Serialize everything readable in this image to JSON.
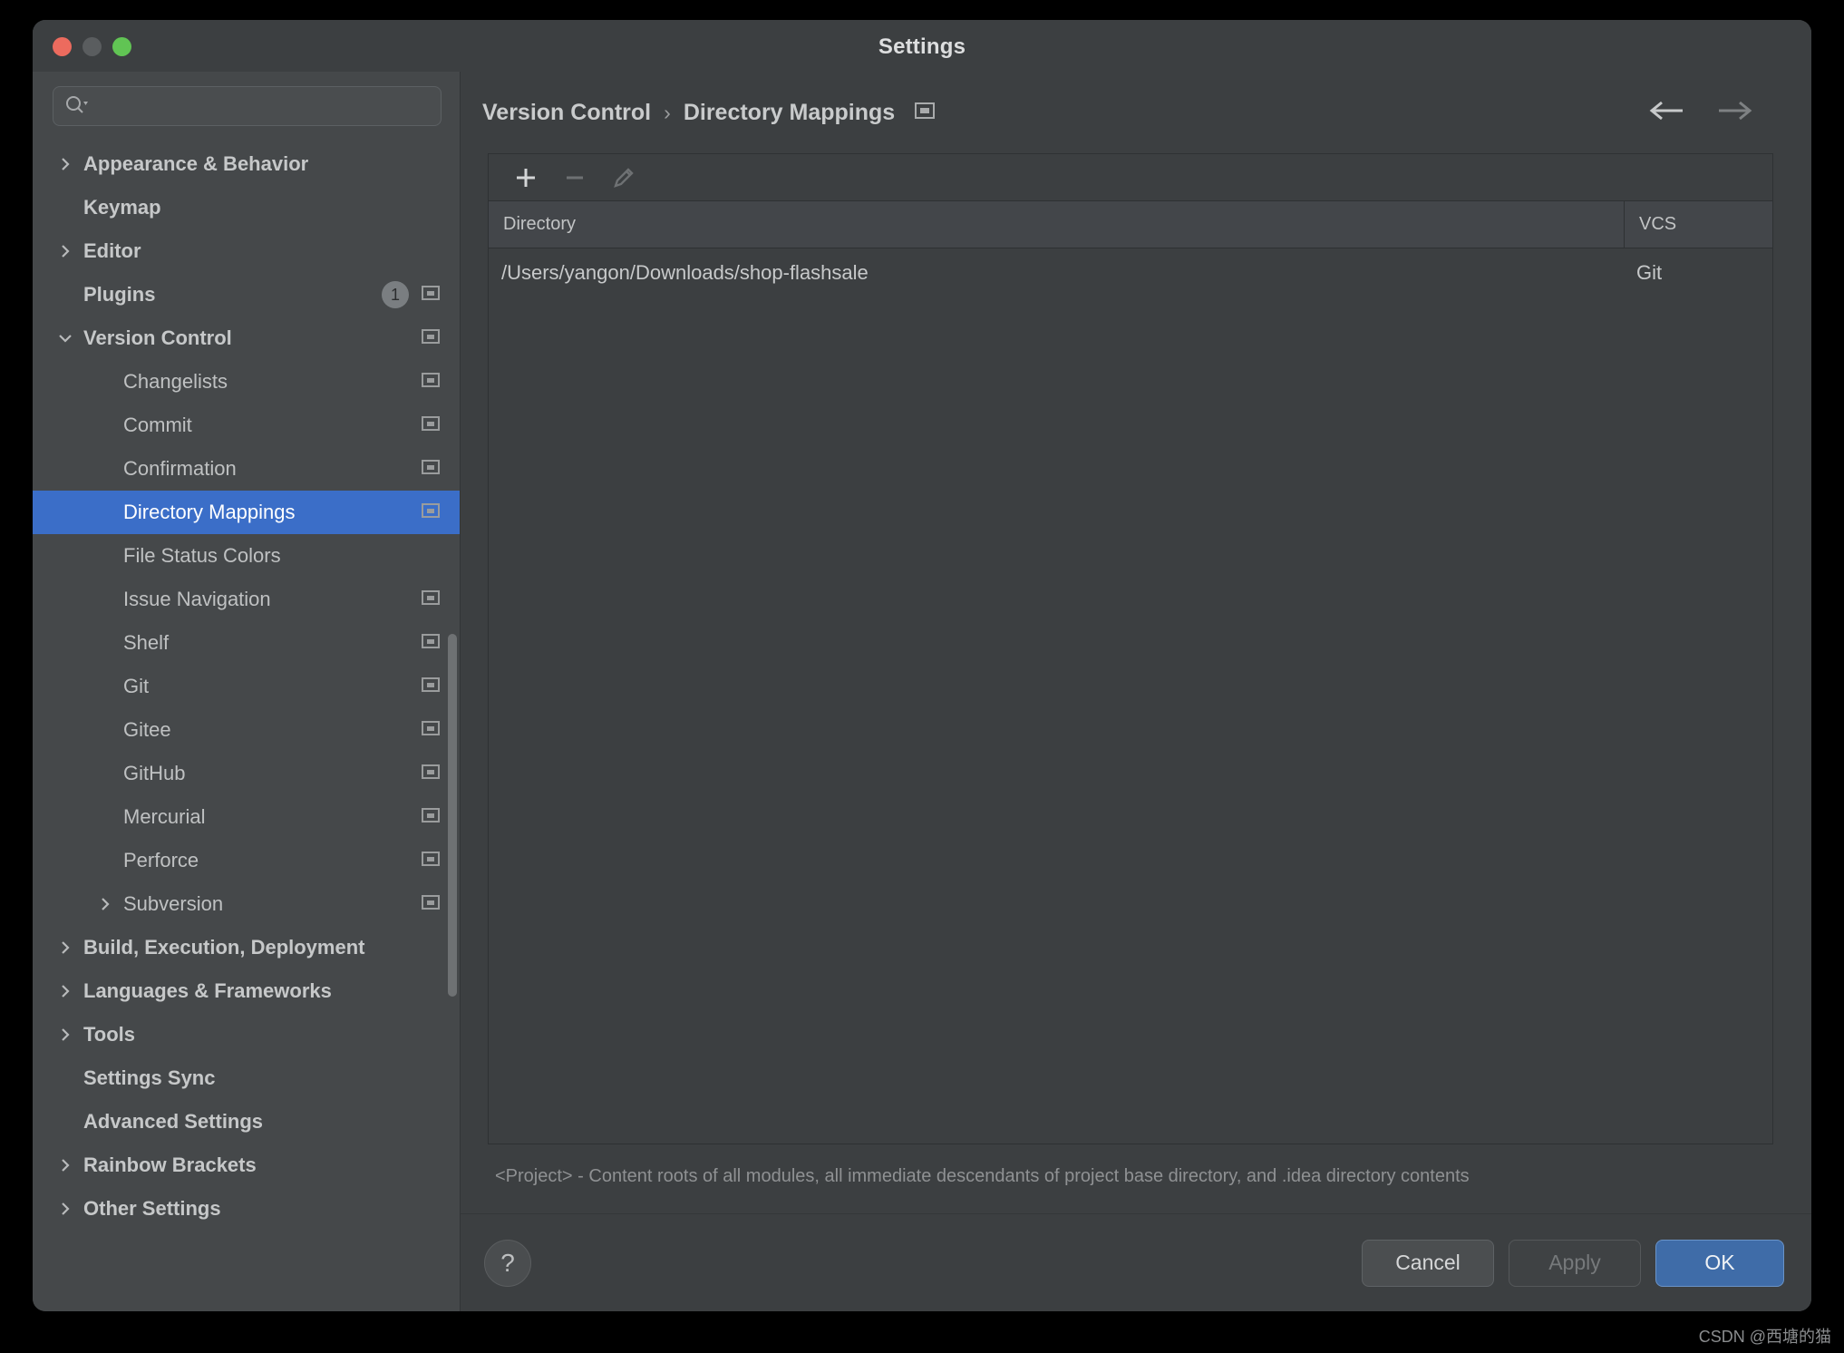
{
  "window": {
    "title": "Settings",
    "traffic_lights": [
      "close",
      "minimize",
      "zoom"
    ]
  },
  "search": {
    "value": "",
    "placeholder": ""
  },
  "sidebar": {
    "items": [
      {
        "label": "Appearance & Behavior",
        "depth": 0,
        "arrow": "right",
        "bold": true,
        "selected": false,
        "badge": null,
        "project_icon": false
      },
      {
        "label": "Keymap",
        "depth": 0,
        "arrow": "",
        "bold": true,
        "selected": false,
        "badge": null,
        "project_icon": false
      },
      {
        "label": "Editor",
        "depth": 0,
        "arrow": "right",
        "bold": true,
        "selected": false,
        "badge": null,
        "project_icon": false
      },
      {
        "label": "Plugins",
        "depth": 0,
        "arrow": "",
        "bold": true,
        "selected": false,
        "badge": "1",
        "project_icon": true
      },
      {
        "label": "Version Control",
        "depth": 0,
        "arrow": "down",
        "bold": true,
        "selected": false,
        "badge": null,
        "project_icon": true
      },
      {
        "label": "Changelists",
        "depth": 1,
        "arrow": "",
        "bold": false,
        "selected": false,
        "badge": null,
        "project_icon": true
      },
      {
        "label": "Commit",
        "depth": 1,
        "arrow": "",
        "bold": false,
        "selected": false,
        "badge": null,
        "project_icon": true
      },
      {
        "label": "Confirmation",
        "depth": 1,
        "arrow": "",
        "bold": false,
        "selected": false,
        "badge": null,
        "project_icon": true
      },
      {
        "label": "Directory Mappings",
        "depth": 1,
        "arrow": "",
        "bold": false,
        "selected": true,
        "badge": null,
        "project_icon": true
      },
      {
        "label": "File Status Colors",
        "depth": 1,
        "arrow": "",
        "bold": false,
        "selected": false,
        "badge": null,
        "project_icon": false
      },
      {
        "label": "Issue Navigation",
        "depth": 1,
        "arrow": "",
        "bold": false,
        "selected": false,
        "badge": null,
        "project_icon": true
      },
      {
        "label": "Shelf",
        "depth": 1,
        "arrow": "",
        "bold": false,
        "selected": false,
        "badge": null,
        "project_icon": true
      },
      {
        "label": "Git",
        "depth": 1,
        "arrow": "",
        "bold": false,
        "selected": false,
        "badge": null,
        "project_icon": true
      },
      {
        "label": "Gitee",
        "depth": 1,
        "arrow": "",
        "bold": false,
        "selected": false,
        "badge": null,
        "project_icon": true
      },
      {
        "label": "GitHub",
        "depth": 1,
        "arrow": "",
        "bold": false,
        "selected": false,
        "badge": null,
        "project_icon": true
      },
      {
        "label": "Mercurial",
        "depth": 1,
        "arrow": "",
        "bold": false,
        "selected": false,
        "badge": null,
        "project_icon": true
      },
      {
        "label": "Perforce",
        "depth": 1,
        "arrow": "",
        "bold": false,
        "selected": false,
        "badge": null,
        "project_icon": true
      },
      {
        "label": "Subversion",
        "depth": 1,
        "arrow": "right",
        "bold": false,
        "selected": false,
        "badge": null,
        "project_icon": true
      },
      {
        "label": "Build, Execution, Deployment",
        "depth": 0,
        "arrow": "right",
        "bold": true,
        "selected": false,
        "badge": null,
        "project_icon": false
      },
      {
        "label": "Languages & Frameworks",
        "depth": 0,
        "arrow": "right",
        "bold": true,
        "selected": false,
        "badge": null,
        "project_icon": false
      },
      {
        "label": "Tools",
        "depth": 0,
        "arrow": "right",
        "bold": true,
        "selected": false,
        "badge": null,
        "project_icon": false
      },
      {
        "label": "Settings Sync",
        "depth": 0,
        "arrow": "",
        "bold": true,
        "selected": false,
        "badge": null,
        "project_icon": false
      },
      {
        "label": "Advanced Settings",
        "depth": 0,
        "arrow": "",
        "bold": true,
        "selected": false,
        "badge": null,
        "project_icon": false
      },
      {
        "label": "Rainbow Brackets",
        "depth": 0,
        "arrow": "right",
        "bold": true,
        "selected": false,
        "badge": null,
        "project_icon": false
      },
      {
        "label": "Other Settings",
        "depth": 0,
        "arrow": "right",
        "bold": true,
        "selected": false,
        "badge": null,
        "project_icon": false
      }
    ]
  },
  "breadcrumb": {
    "parent": "Version Control",
    "separator": "›",
    "current": "Directory Mappings",
    "project_scope_icon": "project-settings-icon",
    "back_label": "←",
    "forward_label": "→"
  },
  "toolbar": {
    "add_label": "+",
    "remove_label": "−",
    "edit_label": "edit-pencil-icon"
  },
  "table": {
    "columns": [
      "Directory",
      "VCS"
    ],
    "rows": [
      {
        "directory": "/Users/yangon/Downloads/shop-flashsale",
        "vcs": "Git"
      }
    ]
  },
  "hint": {
    "text": "<Project> - Content roots of all modules, all immediate descendants of project base directory, and .idea directory contents"
  },
  "footer": {
    "help_label": "?",
    "cancel_label": "Cancel",
    "apply_label": "Apply",
    "ok_label": "OK"
  },
  "watermark": {
    "text": "CSDN @西塘的猫"
  },
  "colors": {
    "accent_selected": "#3B6EC8",
    "primary_button": "#3F6CA8",
    "window_bg": "#3C3F41",
    "sidebar_bg": "#45484A"
  }
}
